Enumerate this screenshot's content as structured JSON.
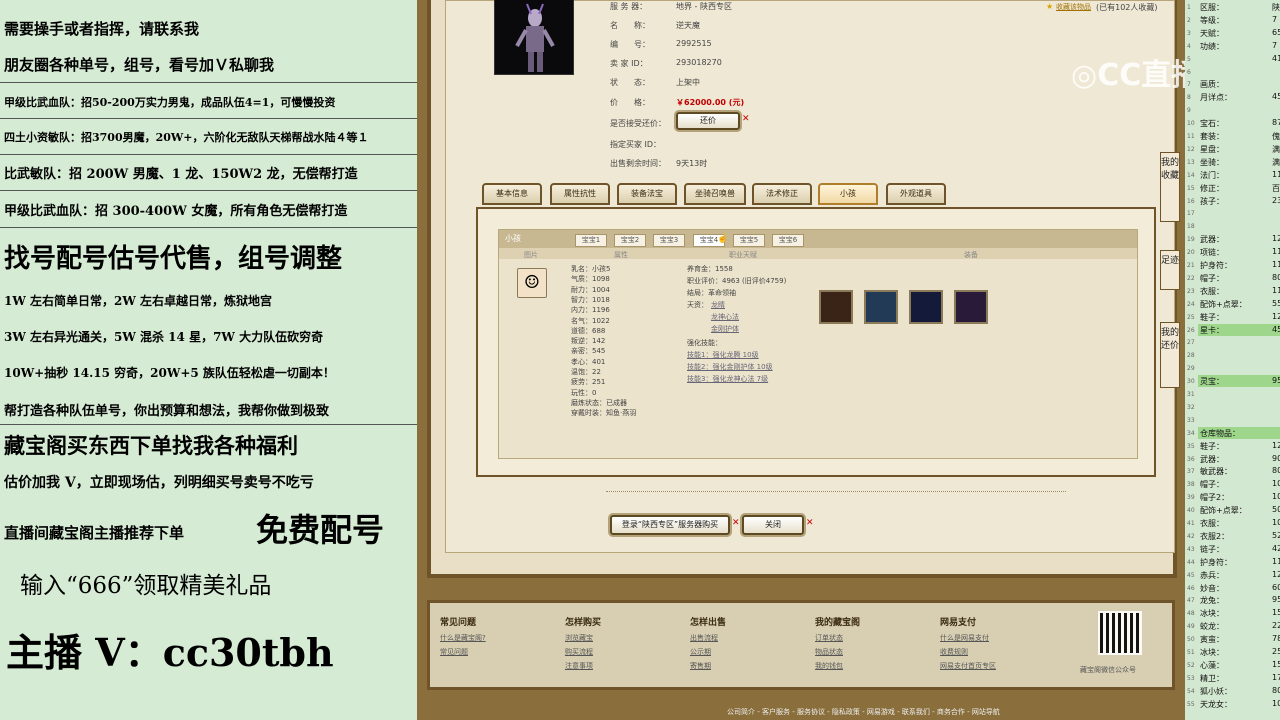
{
  "left_overlay": {
    "lines": [
      "需要操手或者指挥，请联系我",
      "朋友圈各种单号，组号，看号加Ｖ私聊我",
      "甲级比武血队：招50-200万实力男鬼，成品队伍4=1，可慢慢投资",
      "四土小资敏队：招3700男魔，20W+，六阶化无敌队天梯帮战水陆４等１",
      "比武敏队：招 200W 男魔、1 龙、150W2 龙，无偿帮打造",
      "甲级比武血队：招 300-400W 女魔，所有角色无偿帮打造",
      "找号配号估号代售，组号调整",
      "1W 左右简单日常，2W 左右卓越日常，炼狱地宫",
      "3W 左右异光通关，5W 混杀 14 星，7W 大力队伍砍穷奇",
      "10W+抽秒 14.15 穷奇，20W+5 族队伍轻松虐一切副本！",
      "帮打造各种队伍单号，你出预算和想法，我帮你做到极致",
      "藏宝阁买东西下单找我各种福利",
      "估价加我 V，立即现场估，列明细买号卖号不吃亏",
      "直播间藏宝阁主播推荐下单",
      "免费配号",
      "输入“666”领取精美礼品",
      "主播 V：cc30tbh"
    ]
  },
  "char_info": {
    "fav_link": "收藏该物品",
    "fav_count": "(已有102人收藏)",
    "server_label": "服 务 器：",
    "server_value": "地界 - 陕西专区",
    "name_label": "名　　称：",
    "name_value": "逆天魔",
    "id_label": "编　　号：",
    "id_value": "2992515",
    "seller_label": "卖 家 ID：",
    "seller_value": "293018270",
    "status_label": "状　　态：",
    "status_value": "上架中",
    "price_label": "价　　格：",
    "price_value": "￥62000.00 (元)",
    "bargain_label": "是否接受还价：",
    "bargain_button": "还价",
    "buyer_label": "指定买家 ID：",
    "time_label": "出售剩余时间：",
    "time_value": "9天13时"
  },
  "tabs": [
    "基本信息",
    "属性抗性",
    "装备法宝",
    "坐骑召唤兽",
    "法术修正",
    "小孩",
    "外观道具"
  ],
  "child_panel": {
    "title": "小孩",
    "subtabs": [
      "宝宝1",
      "宝宝2",
      "宝宝3",
      "宝宝4",
      "宝宝5",
      "宝宝6"
    ],
    "col_headers": [
      "图片",
      "属性",
      "职业天赋",
      "装备"
    ],
    "stats": [
      "乳名：小孩5",
      "气质：1098",
      "耐力：1004",
      "智力：1018",
      "内力：1196",
      "名气：1022",
      "道德：688",
      "叛逆：142",
      "亲密：545",
      "孝心：401",
      "温饱：22",
      "疲劳：251",
      "玩性：0",
      "磨炼状态：已成器",
      "穿戴时装：知鱼·燕羽"
    ],
    "career": [
      "养育金：1558",
      "职业评价：4963 (旧评价4759)",
      "结局：革命领袖",
      "天资："
    ],
    "talents": [
      "龙睛",
      "龙神心法",
      "金刚护体"
    ],
    "enhance_title": "强化技能：",
    "enhance": [
      "技能1：强化龙腾 10级",
      "技能2：强化金刚护体 10级",
      "技能3：强化龙神心法 7级"
    ]
  },
  "actions": {
    "login_button": "登录“陕西专区”服务器购买",
    "close_button": "关闭"
  },
  "side_tabs": [
    "我的收藏",
    "足迹",
    "我的还价"
  ],
  "watermark": "CC直播",
  "footer": {
    "cols": [
      {
        "title": "常见问题",
        "links": [
          "什么是藏宝阁?",
          "常见问题"
        ]
      },
      {
        "title": "怎样购买",
        "links": [
          "浏览藏宝",
          "购买流程",
          "注意事项"
        ]
      },
      {
        "title": "怎样出售",
        "links": [
          "出售流程",
          "公示期",
          "寄售期"
        ]
      },
      {
        "title": "我的藏宝阁",
        "links": [
          "订单状态",
          "物品状态",
          "我的钱包"
        ]
      },
      {
        "title": "网易支付",
        "links": [
          "什么是网易支付",
          "收费规则",
          "网易支付首页专区"
        ]
      }
    ],
    "qr_caption": "藏宝阁微信公众号",
    "bottom_links": "公司简介 - 客户服务 - 服务协议 - 隐私政策 - 网易游戏 - 联系我们 - 商务合作 - 网站导航"
  },
  "right_panel": {
    "rows": [
      {
        "n": "1",
        "k": "区服：",
        "v": "陕"
      },
      {
        "n": "2",
        "k": "等级：",
        "v": "7"
      },
      {
        "n": "3",
        "k": "天赋：",
        "v": "65"
      },
      {
        "n": "4",
        "k": "功绩：",
        "v": "7"
      },
      {
        "n": "5",
        "k": "",
        "v": "41"
      },
      {
        "n": "6",
        "k": "",
        "v": ""
      },
      {
        "n": "7",
        "k": "画质：",
        "v": ""
      },
      {
        "n": "8",
        "k": "月详点：",
        "v": "45"
      },
      {
        "n": "9",
        "k": "",
        "v": ""
      },
      {
        "n": "10",
        "k": "宝石：",
        "v": "87"
      },
      {
        "n": "11",
        "k": "套装：",
        "v": "傀"
      },
      {
        "n": "12",
        "k": "星盘：",
        "v": "满"
      },
      {
        "n": "13",
        "k": "坐骑：",
        "v": "满"
      },
      {
        "n": "14",
        "k": "法门：",
        "v": "11"
      },
      {
        "n": "15",
        "k": "修正：",
        "v": "百"
      },
      {
        "n": "16",
        "k": "孩子：",
        "v": "23"
      },
      {
        "n": "17",
        "k": "",
        "v": ""
      },
      {
        "n": "18",
        "k": "",
        "v": ""
      },
      {
        "n": "19",
        "k": "武器：",
        "v": "12"
      },
      {
        "n": "20",
        "k": "项链：",
        "v": "11"
      },
      {
        "n": "21",
        "k": "护身符：",
        "v": "11"
      },
      {
        "n": "22",
        "k": "帽子：",
        "v": "80"
      },
      {
        "n": "23",
        "k": "衣服：",
        "v": "11"
      },
      {
        "n": "24",
        "k": "配饰+点翠：",
        "v": "55"
      },
      {
        "n": "25",
        "k": "鞋子：",
        "v": "12"
      },
      {
        "n": "26",
        "k": "星卡：",
        "v": "45"
      },
      {
        "n": "27",
        "k": "",
        "v": ""
      },
      {
        "n": "28",
        "k": "",
        "v": ""
      },
      {
        "n": "29",
        "k": "",
        "v": ""
      },
      {
        "n": "30",
        "k": "灵宝：",
        "v": "95"
      },
      {
        "n": "31",
        "k": "",
        "v": ""
      },
      {
        "n": "32",
        "k": "",
        "v": ""
      },
      {
        "n": "33",
        "k": "",
        "v": ""
      },
      {
        "n": "34",
        "k": "仓库物品：",
        "v": ""
      },
      {
        "n": "35",
        "k": "鞋子：",
        "v": "12"
      },
      {
        "n": "36",
        "k": "武器：",
        "v": "90"
      },
      {
        "n": "37",
        "k": "敏武器：",
        "v": "80"
      },
      {
        "n": "38",
        "k": "帽子：",
        "v": "10"
      },
      {
        "n": "39",
        "k": "帽子2：",
        "v": "10"
      },
      {
        "n": "40",
        "k": "配饰+点翠：",
        "v": "50"
      },
      {
        "n": "41",
        "k": "衣服：",
        "v": "10"
      },
      {
        "n": "42",
        "k": "衣服2：",
        "v": "52"
      },
      {
        "n": "43",
        "k": "链子：",
        "v": "42"
      },
      {
        "n": "44",
        "k": "护身符：",
        "v": "11"
      },
      {
        "n": "45",
        "k": "赤兵：",
        "v": "12"
      },
      {
        "n": "46",
        "k": "妙音：",
        "v": "60"
      },
      {
        "n": "47",
        "k": "龙兔：",
        "v": "95"
      },
      {
        "n": "48",
        "k": "冰块：",
        "v": "15"
      },
      {
        "n": "49",
        "k": "蛟龙：",
        "v": "22"
      },
      {
        "n": "50",
        "k": "寅蛮：",
        "v": "78"
      },
      {
        "n": "51",
        "k": "冰块：",
        "v": "25"
      },
      {
        "n": "52",
        "k": "心藻：",
        "v": "15"
      },
      {
        "n": "53",
        "k": "精卫：",
        "v": "17"
      },
      {
        "n": "54",
        "k": "狐小妖：",
        "v": "80"
      },
      {
        "n": "55",
        "k": "天龙女：",
        "v": "10"
      }
    ]
  }
}
